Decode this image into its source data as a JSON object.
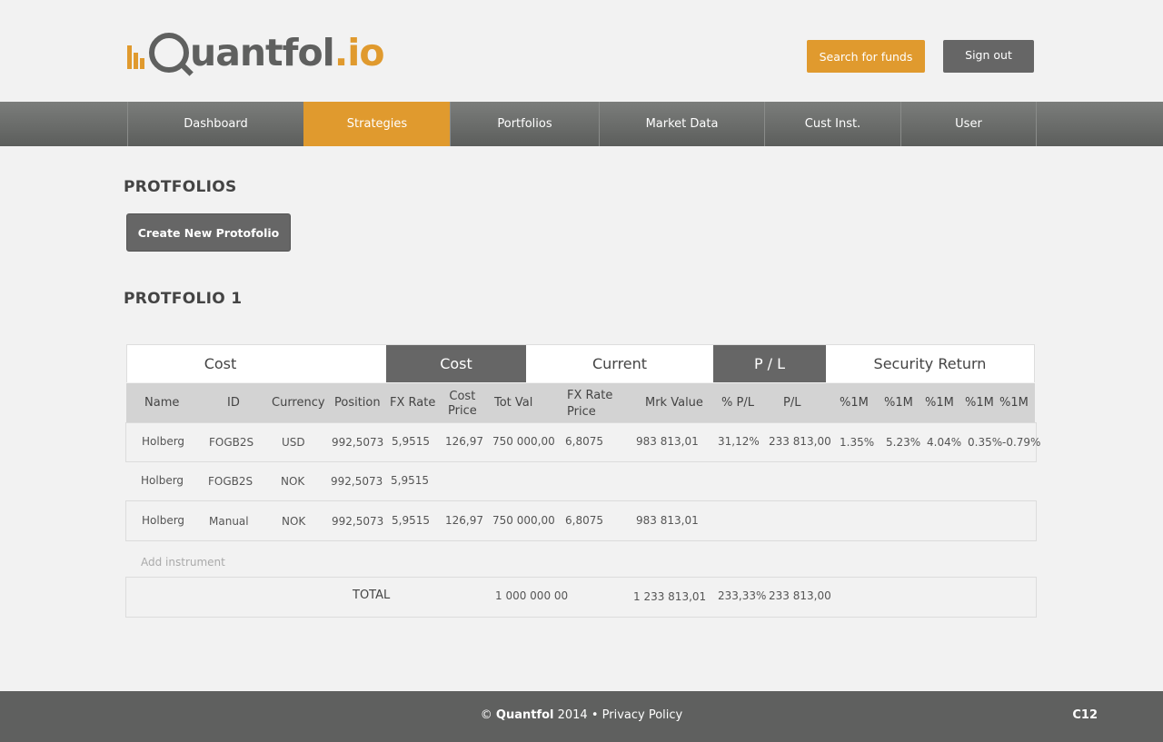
{
  "header": {
    "logo_part1": "uantfol",
    "logo_part2": ".io",
    "search_label": "Search for funds",
    "signout_label": "Sign out"
  },
  "nav": {
    "items": [
      {
        "label": "Dashboard"
      },
      {
        "label": "Strategies"
      },
      {
        "label": "Portfolios"
      },
      {
        "label": "Market Data"
      },
      {
        "label": "Cust Inst."
      },
      {
        "label": "User"
      }
    ],
    "active_index": 1
  },
  "main": {
    "section_title": "PROTFOLIOS",
    "create_label": "Create New Protofolio",
    "portfolio_title": "PROTFOLIO 1"
  },
  "table": {
    "groups": [
      "Cost",
      "Cost",
      "Current",
      "P / L",
      "Security Return"
    ],
    "columns": {
      "name": "Name",
      "id": "ID",
      "currency": "Currency",
      "position": "Position",
      "fx_rate": "FX Rate",
      "cost_price_1": "Cost",
      "cost_price_2": "Price",
      "tot_val": "Tot Val",
      "fx_rate_price_1": "FX Rate",
      "fx_rate_price_2": "Price",
      "mrk_value": "Mrk Value",
      "pct_pl": "% P/L",
      "pl": "P/L",
      "r1": "%1M",
      "r2": "%1M",
      "r3": "%1M",
      "r4": "%1M",
      "r5": "%1M"
    },
    "rows": [
      {
        "name": "Holberg",
        "id": "FOGB2S",
        "currency": "USD",
        "position": "992,5073",
        "fx_rate": "5,9515",
        "cost_price": "126,97",
        "tot_val": "750 000,00",
        "fx_rate_price": "6,8075",
        "mrk_value": "983 813,01",
        "pct_pl": "31,12%",
        "pl": "233 813,00",
        "r1": "1.35%",
        "r2": "5.23%",
        "r3": "4.04%",
        "r4": "0.35%",
        "r5": "-0.79%"
      },
      {
        "name": "Holberg",
        "id": "FOGB2S",
        "currency": "NOK",
        "position": "992,5073",
        "fx_rate": "5,9515"
      },
      {
        "name": "Holberg",
        "id": "Manual",
        "currency": "NOK",
        "position": "992,5073",
        "fx_rate": "5,9515",
        "cost_price": "126,97",
        "tot_val": "750 000,00",
        "fx_rate_price": "6,8075",
        "mrk_value": "983 813,01"
      }
    ],
    "add_instrument": "Add instrument",
    "total": {
      "label": "TOTAL",
      "tot_val": "1 000 000 00",
      "mrk_value": "1 233 813,01",
      "pct_pl": "233,33%",
      "pl": "233 813,00"
    }
  },
  "footer": {
    "copyright": "© ",
    "brand": "Quantfol",
    "rest": " 2014 • Privacy Policy",
    "code": "C12"
  },
  "colors": {
    "accent": "#e09a2e",
    "dark": "#5f605f"
  }
}
